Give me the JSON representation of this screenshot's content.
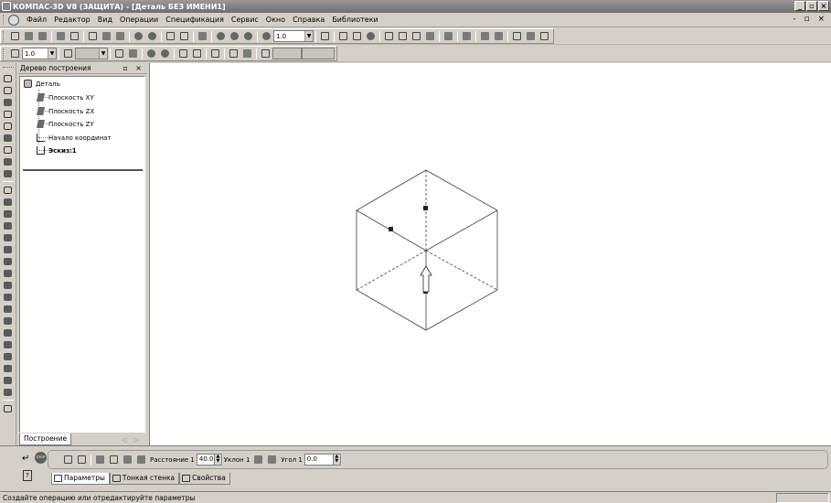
{
  "window": {
    "title": "КОМПАС-3D V8 (ЗАЩИТА) - [Деталь БЕЗ ИМЕНИ1]",
    "buttons": [
      "_",
      "▫",
      "×"
    ]
  },
  "menu": {
    "items": [
      "Файл",
      "Редактор",
      "Вид",
      "Операции",
      "Спецификация",
      "Сервис",
      "Окно",
      "Справка",
      "Библиотеки"
    ],
    "mdi_controls": "- ▫ ×"
  },
  "toolbar": {
    "zoom_value": "1.0",
    "line_scale_value": "1.0"
  },
  "tree": {
    "title": "Дерево построения",
    "header_buttons": "▫ ×",
    "root": "Деталь",
    "items": [
      "Плоскость XY",
      "Плоскость ZX",
      "Плоскость ZY",
      "Начало координат",
      "Эскиз:1"
    ],
    "tab": "Построение",
    "tab_arrows": "◁ ▷"
  },
  "properties": {
    "distance_label": "Расстояние 1",
    "distance_value": "40.0",
    "slope_label": "Уклон 1",
    "angle_label": "Угол 1",
    "angle_value": "0.0",
    "tabs": [
      "Параметры",
      "Тонкая стенка",
      "Свойства"
    ],
    "stop_label": "STOP"
  },
  "status": {
    "text": "Создайте операцию или отредактируйте параметры"
  }
}
